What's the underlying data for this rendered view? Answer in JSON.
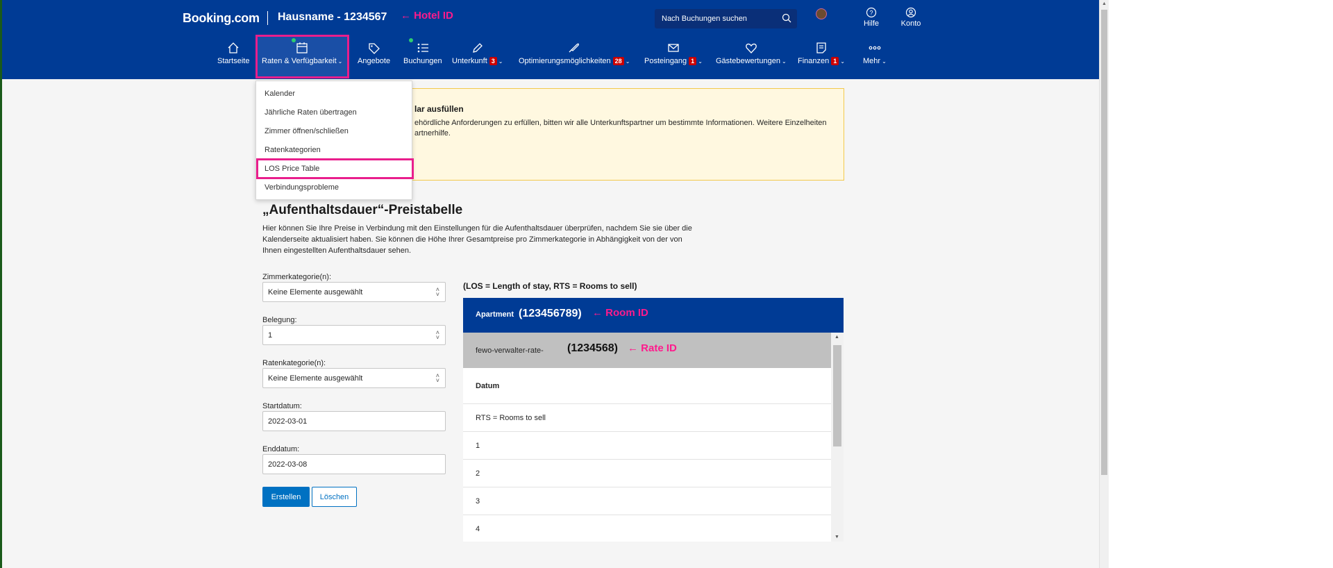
{
  "header": {
    "brand": "Booking.com",
    "hotel_name": "Hausname - 1234567",
    "hotel_annotation": "← Hotel ID",
    "search_placeholder": "Nach Buchungen suchen",
    "help_label": "Hilfe",
    "account_label": "Konto",
    "brand_color": "#003b95"
  },
  "nav": {
    "items": [
      {
        "label": "Startseite",
        "icon": "home-icon"
      },
      {
        "label": "Raten & Verfügbarkeit",
        "icon": "calendar-icon"
      },
      {
        "label": "Angebote",
        "icon": "tag-icon"
      },
      {
        "label": "Buchungen",
        "icon": "list-icon"
      },
      {
        "label": "Unterkunft",
        "icon": "pencil-icon",
        "badge": "3"
      },
      {
        "label": "Optimierungsmöglichkeiten",
        "icon": "rocket-icon",
        "badge": "28"
      },
      {
        "label": "Posteingang",
        "icon": "mail-icon",
        "badge": "1"
      },
      {
        "label": "Gästebewertungen",
        "icon": "heart-icon"
      },
      {
        "label": "Finanzen",
        "icon": "document-icon",
        "badge": "1"
      },
      {
        "label": "Mehr",
        "icon": "more-icon"
      }
    ]
  },
  "dropdown": {
    "items": [
      "Kalender",
      "Jährliche Raten übertragen",
      "Zimmer öffnen/schließen",
      "Ratenkategorien",
      "LOS Price Table",
      "Verbindungsprobleme"
    ]
  },
  "alert": {
    "title": "lar ausfüllen",
    "line1": "ehördliche Anforderungen zu erfüllen, bitten wir alle Unterkunftspartner um bestimmte Informationen. Weitere Einzelheiten",
    "line2": "artnerhilfe."
  },
  "page": {
    "title": "„Aufenthaltsdauer“-Preistabelle",
    "description": "Hier können Sie Ihre Preise in Verbindung mit den Einstellungen für die Aufenthaltsdauer überprüfen, nachdem Sie sie über die Kalenderseite aktualisiert haben. Sie können die Höhe Ihrer Gesamtpreise pro Zimmerkategorie in Abhängigkeit von der von Ihnen eingestellten Aufenthaltsdauer sehen."
  },
  "form": {
    "room_label": "Zimmerkategorie(n):",
    "room_value": "Keine Elemente ausgewählt",
    "occupancy_label": "Belegung:",
    "occupancy_value": "1",
    "rate_label": "Ratenkategorie(n):",
    "rate_value": "Keine Elemente ausgewählt",
    "start_label": "Startdatum:",
    "start_value": "2022-03-01",
    "end_label": "Enddatum:",
    "end_value": "2022-03-08",
    "create_button": "Erstellen",
    "delete_button": "Löschen"
  },
  "table": {
    "legend": "(LOS = Length of stay, RTS = Rooms to sell)",
    "room_name": "Apartment",
    "room_id": "(123456789)",
    "room_annotation": "← Room ID",
    "rate_name": "fewo-verwalter-rate-",
    "rate_id": "(1234568)",
    "rate_annotation": "← Rate ID",
    "date_header": "Datum",
    "rts_label": "RTS = Rooms to sell",
    "rows": [
      "1",
      "2",
      "3",
      "4"
    ]
  },
  "colors": {
    "highlight": "#e91e8c",
    "primary_button": "#0071c2",
    "alert_bg": "#fff8e0"
  }
}
